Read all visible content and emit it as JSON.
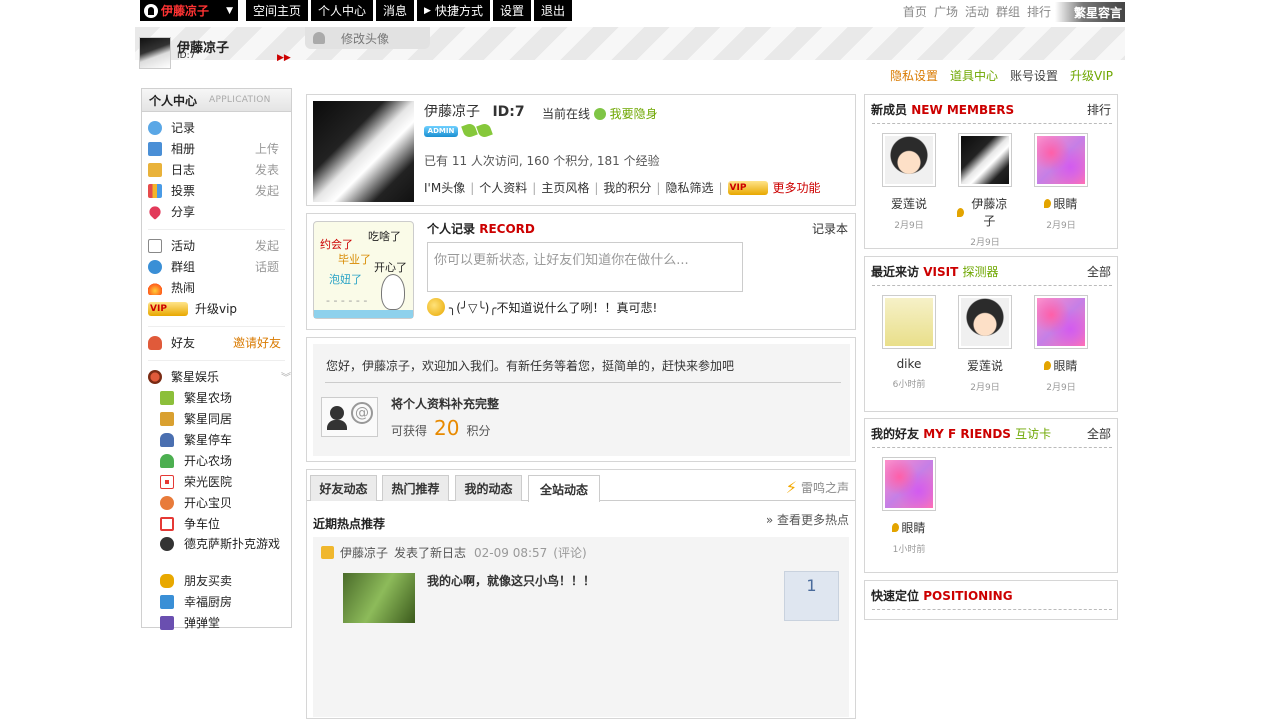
{
  "topbar": {
    "username": "伊藤凉子",
    "buttons": [
      "空间主页",
      "个人中心",
      "消息",
      "快捷方式",
      "设置",
      "退出"
    ],
    "shortcut_icon": "arrow-right-icon",
    "right_links": [
      "首页",
      "广场",
      "活动",
      "群组",
      "排行"
    ],
    "brand": "繁星容言"
  },
  "banner": {
    "name": "伊藤凉子",
    "id": "ID:7",
    "edit_avatar": "修改头像",
    "links": [
      "隐私设置",
      "道具中心",
      "账号设置",
      "升级VIP"
    ],
    "link_colors": [
      "#d97a00",
      "#6ea700",
      "#444444",
      "#6ea700"
    ]
  },
  "sidebar": {
    "title": "个人中心",
    "subtitle": "APPLICATION",
    "items": [
      {
        "label": "记录",
        "action": "",
        "icon": "speech-bubble-icon",
        "color": "#5aa7e6"
      },
      {
        "label": "相册",
        "action": "上传",
        "icon": "photo-icon",
        "color": "#4a8fd6"
      },
      {
        "label": "日志",
        "action": "发表",
        "icon": "notebook-icon",
        "color": "#e9b23a"
      },
      {
        "label": "投票",
        "action": "发起",
        "icon": "bar-chart-icon",
        "color": "#e64b4b"
      },
      {
        "label": "分享",
        "action": "",
        "icon": "heart-icon",
        "color": "#e23a5a"
      }
    ],
    "items2": [
      {
        "label": "活动",
        "action": "发起",
        "icon": "calendar-icon",
        "color": "#888888"
      },
      {
        "label": "群组",
        "action": "话题",
        "icon": "group-icon",
        "color": "#3a8fd6"
      },
      {
        "label": "热闹",
        "action": "",
        "icon": "fire-icon",
        "color": "#ff5a1a"
      },
      {
        "label": "升级vip",
        "action": "",
        "icon": "vip-diamond-icon",
        "color": "#e8a800",
        "badge": "VIP"
      }
    ],
    "friends": {
      "label": "好友",
      "action": "邀请好友",
      "icon": "friend-icon",
      "color": "#e05a3a"
    },
    "apps_title": "繁星娱乐",
    "apps": [
      {
        "label": "繁星农场",
        "icon": "farm-icon",
        "color": "#8cbf3a"
      },
      {
        "label": "繁星同居",
        "icon": "house-icon",
        "color": "#d9a030"
      },
      {
        "label": "繁星停车",
        "icon": "car-icon",
        "color": "#4a6fb0"
      },
      {
        "label": "开心农场",
        "icon": "plant-icon",
        "color": "#4caf50"
      },
      {
        "label": "荣光医院",
        "icon": "red-cross-icon",
        "color": "#e53935"
      },
      {
        "label": "开心宝贝",
        "icon": "baby-icon",
        "color": "#e87b3a"
      },
      {
        "label": "争车位",
        "icon": "parking-icon",
        "color": "#e53935"
      },
      {
        "label": "德克萨斯扑克游戏",
        "icon": "poker-icon",
        "color": "#333333"
      },
      {
        "label": "朋友买卖",
        "icon": "coins-icon",
        "color": "#e8a800"
      },
      {
        "label": "幸福厨房",
        "icon": "kitchen-icon",
        "color": "#3a8fd6"
      },
      {
        "label": "弹弹堂",
        "icon": "game-icon",
        "color": "#6a4fb0"
      }
    ]
  },
  "profile": {
    "name": "伊藤凉子",
    "id": "ID:7",
    "online": "当前在线",
    "hide": "我要隐身",
    "admin": "ADMIN",
    "stats": "已有 11 人次访问, 160 个积分, 181 个经验",
    "links": [
      "I'M头像",
      "个人资料",
      "主页风格",
      "我的积分",
      "隐私筛选"
    ],
    "vip": "VIP",
    "more": "更多功能"
  },
  "record": {
    "title": "个人记录",
    "title_en": "RECORD",
    "book": "记录本",
    "placeholder": "你可以更新状态, 让好友们知道你在做什么...",
    "status": "╮(╯▽╰)╭不知道说什么了咧！！真可悲!",
    "cartoon": [
      "约会了",
      "吃啥了",
      "毕业了",
      "泡妞了",
      "开心了",
      "- - - - - -"
    ]
  },
  "task": {
    "welcome": "您好，伊藤凉子，欢迎加入我们。有新任务等着您，挺简单的，赶快来参加吧",
    "title": "将个人资料补充完整",
    "reward_prefix": "可获得",
    "reward_num": "20",
    "reward_unit": "积分"
  },
  "feed": {
    "tabs": [
      "好友动态",
      "热门推荐",
      "我的动态",
      "全站动态"
    ],
    "active_tab": 3,
    "right_label": "雷鸣之声",
    "hot_title": "近期热点推荐",
    "hot_more": "» 查看更多热点",
    "item": {
      "user": "伊藤凉子",
      "action": "发表了新日志",
      "time": "02-09 08:57",
      "comment": "(评论)",
      "title": "我的心啊，就像这只小鸟！！！",
      "votes": "1"
    }
  },
  "new_members": {
    "title": "新成员",
    "title_en": "NEW MEMBERS",
    "action": "排行",
    "members": [
      {
        "name": "爱莲说",
        "date": "2月9日",
        "pin": false,
        "avatar": "av-kid"
      },
      {
        "name": "伊藤凉子",
        "date": "2月9日",
        "pin": true,
        "avatar": "av-dark"
      },
      {
        "name": "眼睛",
        "date": "2月9日",
        "pin": true,
        "avatar": "av-pink"
      }
    ]
  },
  "visitors": {
    "title": "最近来访",
    "title_en": "VISIT",
    "title_extra": "探测器",
    "action": "全部",
    "members": [
      {
        "name": "dike",
        "date": "6小时前",
        "pin": false,
        "avatar": "av-sign"
      },
      {
        "name": "爱莲说",
        "date": "2月9日",
        "pin": false,
        "avatar": "av-kid"
      },
      {
        "name": "眼睛",
        "date": "2月9日",
        "pin": true,
        "avatar": "av-pink"
      }
    ]
  },
  "friends": {
    "title": "我的好友",
    "title_en": "MY F RIENDS",
    "title_extra": "互访卡",
    "action": "全部",
    "members": [
      {
        "name": "眼睛",
        "date": "1小时前",
        "pin": true,
        "avatar": "av-pink"
      }
    ]
  },
  "positioning": {
    "title": "快速定位",
    "title_en": "POSITIONING"
  }
}
